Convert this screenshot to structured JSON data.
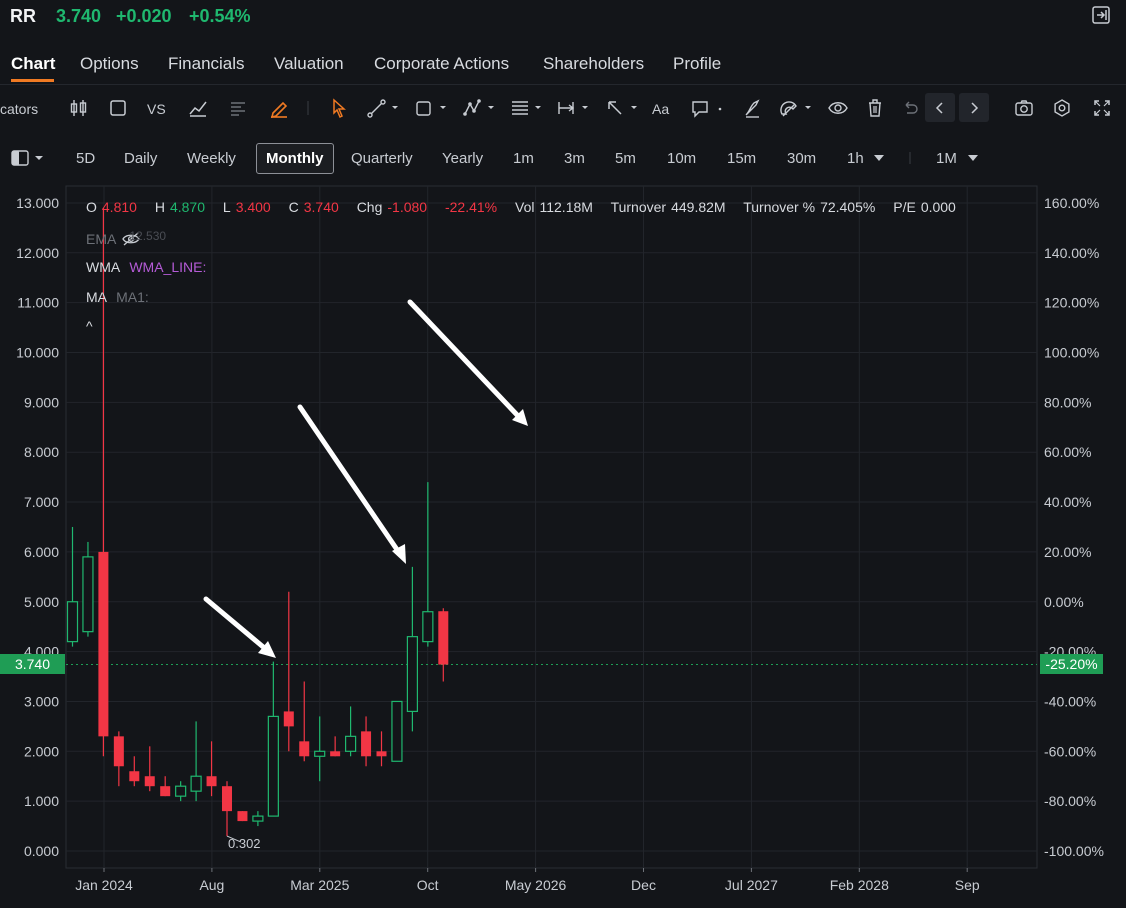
{
  "quote": {
    "ticker": "RR",
    "price": "3.740",
    "change": "+0.020",
    "change_pct": "+0.54%"
  },
  "tabs": [
    "Chart",
    "Options",
    "Financials",
    "Valuation",
    "Corporate Actions",
    "Shareholders",
    "Profile"
  ],
  "toolbar": {
    "indicators_label": "cators",
    "vs_label": "VS",
    "text_label": "Aa"
  },
  "periods": [
    "5D",
    "Daily",
    "Weekly",
    "Monthly",
    "Quarterly",
    "Yearly",
    "1m",
    "3m",
    "5m",
    "10m",
    "15m",
    "30m",
    "1h",
    "1M"
  ],
  "ohlc": {
    "o_label": "O",
    "o": "4.810",
    "h_label": "H",
    "h": "4.870",
    "l_label": "L",
    "l": "3.400",
    "c_label": "C",
    "c": "3.740",
    "chg_label": "Chg",
    "chg": "-1.080",
    "chg_pct": "-22.41%",
    "vol_label": "Vol",
    "vol": "112.18M",
    "turnover_label": "Turnover",
    "turnover": "449.82M",
    "turnover_pct_label": "Turnover %",
    "turnover_pct": "72.405%",
    "pe_label": "P/E",
    "pe": "0.000"
  },
  "indicators": {
    "ema": "EMA",
    "ema_value": "12.530",
    "wma": "WMA",
    "wma_line": "WMA_LINE:",
    "ma": "MA",
    "ma1": "MA1:",
    "collapse": "^"
  },
  "colors": {
    "up": "#1fb86f",
    "down": "#f23645",
    "accent": "#f07a23",
    "tag": "#1f9d55"
  },
  "chart_data": {
    "type": "candlestick",
    "y_left_ticks": [
      "13.000",
      "12.000",
      "11.000",
      "10.000",
      "9.000",
      "8.000",
      "7.000",
      "6.000",
      "5.000",
      "4.000",
      "3.000",
      "2.000",
      "1.000",
      "0.000"
    ],
    "y_right_ticks": [
      "160.00%",
      "140.00%",
      "120.00%",
      "100.00%",
      "80.00%",
      "60.00%",
      "40.00%",
      "20.00%",
      "0.00%",
      "-20.00%",
      "-40.00%",
      "-60.00%",
      "-80.00%",
      "-100.00%"
    ],
    "x_ticks": [
      "Jan 2024",
      "Aug",
      "Mar 2025",
      "Oct",
      "May 2026",
      "Dec",
      "Jul 2027",
      "Feb 2028",
      "Sep"
    ],
    "ylim": [
      0,
      13
    ],
    "current_price": "3.740",
    "current_pct": "-25.20%",
    "low_label": "0.302",
    "candles": [
      {
        "o": 4.2,
        "h": 6.5,
        "l": 4.1,
        "c": 5.0
      },
      {
        "o": 4.4,
        "h": 6.2,
        "l": 4.3,
        "c": 5.9
      },
      {
        "o": 6.0,
        "h": 12.9,
        "l": 1.9,
        "c": 2.3
      },
      {
        "o": 2.3,
        "h": 2.4,
        "l": 1.3,
        "c": 1.7
      },
      {
        "o": 1.6,
        "h": 1.9,
        "l": 1.3,
        "c": 1.4
      },
      {
        "o": 1.5,
        "h": 2.1,
        "l": 1.2,
        "c": 1.3
      },
      {
        "o": 1.3,
        "h": 1.5,
        "l": 1.1,
        "c": 1.1
      },
      {
        "o": 1.1,
        "h": 1.4,
        "l": 1.0,
        "c": 1.3
      },
      {
        "o": 1.2,
        "h": 2.6,
        "l": 1.0,
        "c": 1.5
      },
      {
        "o": 1.5,
        "h": 2.2,
        "l": 1.1,
        "c": 1.3
      },
      {
        "o": 1.3,
        "h": 1.4,
        "l": 0.3,
        "c": 0.8
      },
      {
        "o": 0.8,
        "h": 0.8,
        "l": 0.6,
        "c": 0.6
      },
      {
        "o": 0.6,
        "h": 0.8,
        "l": 0.5,
        "c": 0.7
      },
      {
        "o": 0.7,
        "h": 3.8,
        "l": 0.7,
        "c": 2.7
      },
      {
        "o": 2.8,
        "h": 5.2,
        "l": 2.0,
        "c": 2.5
      },
      {
        "o": 2.2,
        "h": 3.4,
        "l": 1.8,
        "c": 1.9
      },
      {
        "o": 1.9,
        "h": 2.7,
        "l": 1.4,
        "c": 2.0
      },
      {
        "o": 2.0,
        "h": 2.3,
        "l": 1.9,
        "c": 1.9
      },
      {
        "o": 2.0,
        "h": 2.9,
        "l": 1.9,
        "c": 2.3
      },
      {
        "o": 2.4,
        "h": 2.7,
        "l": 1.7,
        "c": 1.9
      },
      {
        "o": 2.0,
        "h": 2.4,
        "l": 1.7,
        "c": 1.9
      },
      {
        "o": 1.8,
        "h": 3.0,
        "l": 1.8,
        "c": 3.0
      },
      {
        "o": 2.8,
        "h": 5.7,
        "l": 2.4,
        "c": 4.3
      },
      {
        "o": 4.2,
        "h": 7.4,
        "l": 4.1,
        "c": 4.8
      },
      {
        "o": 4.81,
        "h": 4.87,
        "l": 3.4,
        "c": 3.74
      }
    ]
  }
}
